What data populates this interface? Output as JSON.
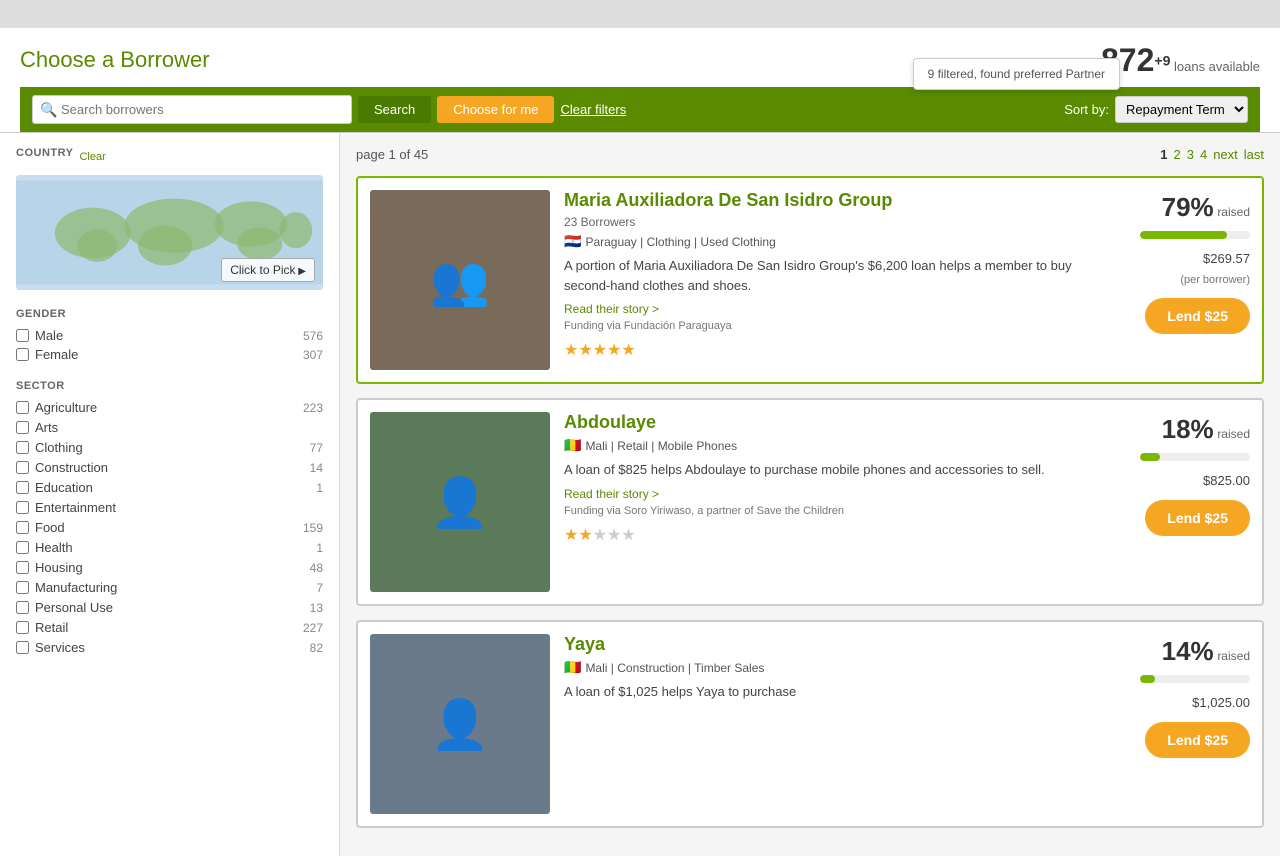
{
  "page": {
    "title": "Choose a Borrower",
    "loans_number": "872",
    "loans_sup": "+9",
    "loans_label": "loans available",
    "tooltip": "9 filtered, found preferred Partner"
  },
  "search": {
    "placeholder": "Search borrowers",
    "search_btn": "Search",
    "choose_btn": "Choose for me",
    "clear_btn": "Clear filters",
    "sort_label": "Sort by:",
    "sort_value": "Repayment Term"
  },
  "pagination": {
    "info": "page 1 of 45",
    "pages": [
      "1",
      "2",
      "3",
      "4"
    ],
    "next": "next",
    "last": "last"
  },
  "sidebar": {
    "country_title": "COUNTRY",
    "clear_link": "Clear",
    "click_to_pick": "Click to Pick",
    "gender_title": "GENDER",
    "genders": [
      {
        "label": "Male",
        "count": "576"
      },
      {
        "label": "Female",
        "count": "307"
      }
    ],
    "sector_title": "SECTOR",
    "sectors": [
      {
        "label": "Agriculture",
        "count": "223"
      },
      {
        "label": "Arts",
        "count": ""
      },
      {
        "label": "Clothing",
        "count": "77"
      },
      {
        "label": "Construction",
        "count": "14"
      },
      {
        "label": "Education",
        "count": "1"
      },
      {
        "label": "Entertainment",
        "count": ""
      },
      {
        "label": "Food",
        "count": "159"
      },
      {
        "label": "Health",
        "count": "1"
      },
      {
        "label": "Housing",
        "count": "48"
      },
      {
        "label": "Manufacturing",
        "count": "7"
      },
      {
        "label": "Personal Use",
        "count": "13"
      },
      {
        "label": "Retail",
        "count": "227"
      },
      {
        "label": "Services",
        "count": "82"
      }
    ]
  },
  "loans": [
    {
      "id": "loan-1",
      "name": "Maria Auxiliadora De San Isidro Group",
      "borrowers": "23 Borrowers",
      "flag": "🇵🇾",
      "country": "Paraguay",
      "categories": "Clothing | Used Clothing",
      "description": "A portion of Maria Auxiliadora De San Isidro Group's $6,200 loan helps a member to buy second-hand clothes and shoes.",
      "read_story": "Read their story >",
      "funding": "Funding via Fundación Paraguaya",
      "stars": 4.5,
      "pct": "79%",
      "raised": "raised",
      "progress": 79,
      "amount": "$269.57",
      "per_borrower": "(per borrower)",
      "lend_btn": "Lend $25",
      "highlight": true
    },
    {
      "id": "loan-2",
      "name": "Abdoulaye",
      "borrowers": "",
      "flag": "🇲🇱",
      "country": "Mali",
      "categories": "Retail | Mobile Phones",
      "description": "A loan of $825 helps Abdoulaye to purchase mobile phones and accessories to sell.",
      "read_story": "Read their story >",
      "funding": "Funding via Soro Yiriwaso, a partner of Save the Children",
      "stars": 2,
      "pct": "18%",
      "raised": "raised",
      "progress": 18,
      "amount": "$825.00",
      "per_borrower": "",
      "lend_btn": "Lend $25",
      "highlight": false
    },
    {
      "id": "loan-3",
      "name": "Yaya",
      "borrowers": "",
      "flag": "🇲🇱",
      "country": "Mali",
      "categories": "Construction | Timber Sales",
      "description": "A loan of $1,025 helps Yaya to purchase",
      "read_story": "",
      "funding": "",
      "stars": 0,
      "pct": "14%",
      "raised": "raised",
      "progress": 14,
      "amount": "$1,025.00",
      "per_borrower": "",
      "lend_btn": "Lend $25",
      "highlight": false
    }
  ]
}
